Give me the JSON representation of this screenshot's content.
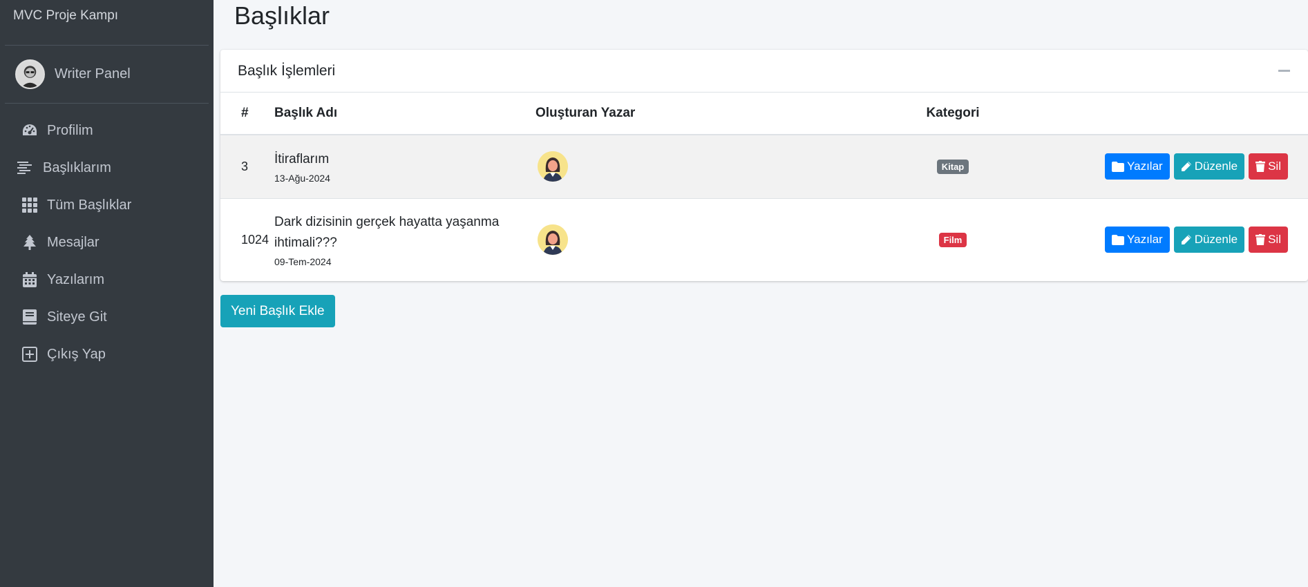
{
  "sidebar": {
    "brand": "MVC Proje Kampı",
    "user_name": "Writer Panel",
    "items": [
      {
        "label": "Profilim",
        "icon": "tachometer-icon"
      },
      {
        "label": "Başlıklarım",
        "icon": "stream-icon"
      },
      {
        "label": "Tüm Başlıklar",
        "icon": "grid-icon"
      },
      {
        "label": "Mesajlar",
        "icon": "tree-icon"
      },
      {
        "label": "Yazılarım",
        "icon": "calendar-icon"
      },
      {
        "label": "Siteye Git",
        "icon": "book-icon"
      },
      {
        "label": "Çıkış Yap",
        "icon": "plus-square-icon"
      }
    ]
  },
  "page": {
    "title": "Başlıklar"
  },
  "card": {
    "title": "Başlık İşlemleri"
  },
  "table": {
    "headers": [
      "#",
      "Başlık Adı",
      "Oluşturan Yazar",
      "Kategori"
    ],
    "rows": [
      {
        "id": "3",
        "title": "İtiraflarım",
        "date": "13-Ağu-2024",
        "category": "Kitap",
        "category_color": "#6c757d"
      },
      {
        "id": "1024",
        "title": "Dark dizisinin gerçek hayatta yaşanma ihtimali???",
        "date": "09-Tem-2024",
        "category": "Film",
        "category_color": "#dc3545"
      }
    ],
    "actions": {
      "posts": "Yazılar",
      "edit": "Düzenle",
      "delete": "Sil"
    }
  },
  "add_button": "Yeni Başlık Ekle",
  "colors": {
    "sidebar_bg": "#343a40",
    "primary": "#007bff",
    "info": "#17a2b8",
    "danger": "#dc3545",
    "secondary": "#6c757d"
  }
}
